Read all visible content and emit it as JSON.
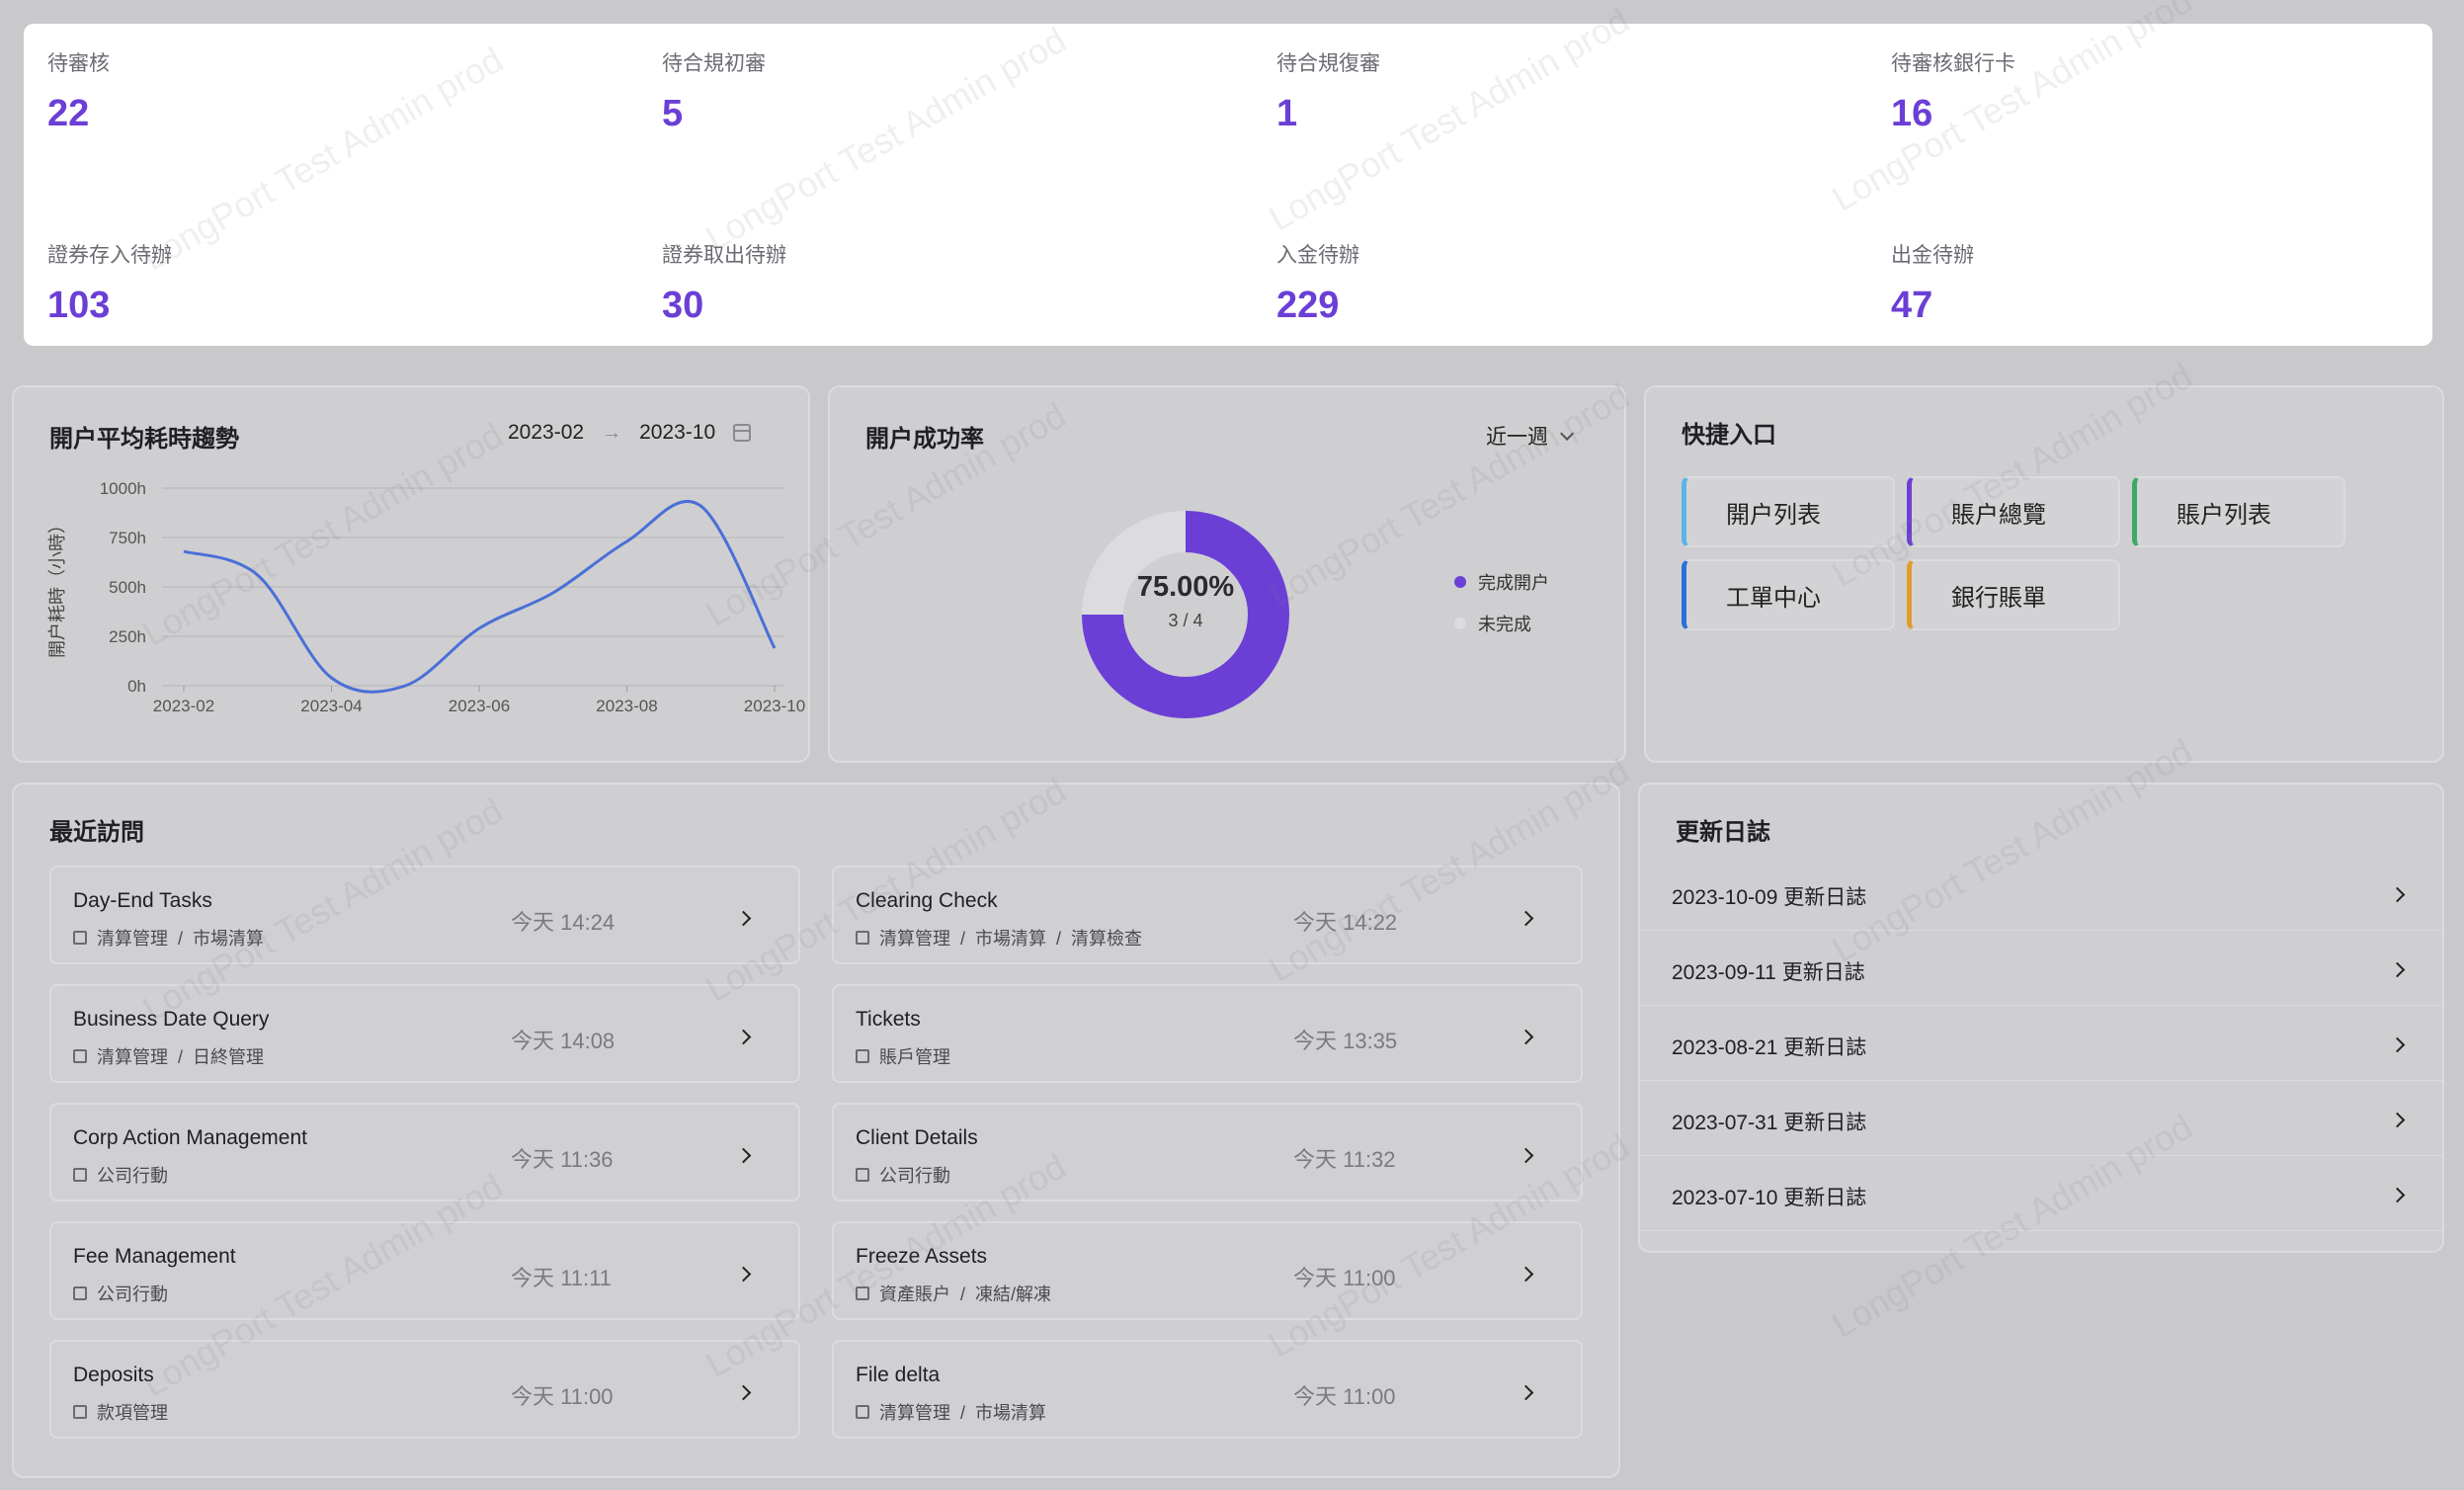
{
  "stats": [
    {
      "label": "待審核",
      "value": "22"
    },
    {
      "label": "待合規初審",
      "value": "5"
    },
    {
      "label": "待合規復審",
      "value": "1"
    },
    {
      "label": "待審核銀行卡",
      "value": "16"
    },
    {
      "label": "證券存入待辦",
      "value": "103"
    },
    {
      "label": "證券取出待辦",
      "value": "30"
    },
    {
      "label": "入金待辦",
      "value": "229"
    },
    {
      "label": "出金待辦",
      "value": "47"
    }
  ],
  "trend": {
    "title": "開户平均耗時趨勢",
    "range_start": "2023-02",
    "range_end": "2023-10",
    "range_arrow": "→"
  },
  "chart_data": {
    "type": "line",
    "title": "開户平均耗時趨勢",
    "ylabel": "開户耗時（小時）",
    "xlabel": "",
    "x": [
      "2023-02",
      "2023-03",
      "2023-04",
      "2023-05",
      "2023-06",
      "2023-07",
      "2023-08",
      "2023-09",
      "2023-10"
    ],
    "y_ticks": [
      "0h",
      "250h",
      "500h",
      "750h",
      "1000h"
    ],
    "x_ticks": [
      "2023-02",
      "2023-04",
      "2023-06",
      "2023-08",
      "2023-10"
    ],
    "ylim": [
      0,
      1000
    ],
    "series": [
      {
        "values": [
          680,
          560,
          40,
          0,
          290,
          470,
          730,
          910,
          190
        ],
        "color": "#4a6fd8"
      }
    ],
    "grid": true
  },
  "donut": {
    "title": "開户成功率",
    "period": "近一週",
    "percent_text": "75.00%",
    "ratio_text": "3 / 4",
    "completed_fraction": 0.75,
    "legend": [
      {
        "label": "完成開户",
        "color": "#6b3fd6"
      },
      {
        "label": "未完成",
        "color": "#dcdcde"
      }
    ]
  },
  "shortcuts": {
    "title": "快捷入口",
    "items": [
      {
        "label": "開户列表",
        "color": "#5ab4e6"
      },
      {
        "label": "賬户總覽",
        "color": "#6b3fd6"
      },
      {
        "label": "賬户列表",
        "color": "#3fa868"
      },
      {
        "label": "工單中心",
        "color": "#2d6fd9"
      },
      {
        "label": "銀行賬單",
        "color": "#e09c2e"
      }
    ]
  },
  "recent": {
    "title": "最近訪問",
    "items": [
      {
        "name": "Day-End Tasks",
        "path": "清算管理  /  市場清算",
        "time": "今天 14:24"
      },
      {
        "name": "Clearing Check",
        "path": "清算管理  /  市場清算  /  清算檢查",
        "time": "今天 14:22"
      },
      {
        "name": "Business Date Query",
        "path": "清算管理  /  日終管理",
        "time": "今天 14:08"
      },
      {
        "name": "Tickets",
        "path": "賬戶管理",
        "time": "今天 13:35"
      },
      {
        "name": "Corp Action Management",
        "path": "公司行動",
        "time": "今天 11:36"
      },
      {
        "name": "Client Details",
        "path": "公司行動",
        "time": "今天 11:32"
      },
      {
        "name": "Fee Management",
        "path": "公司行動",
        "time": "今天 11:11"
      },
      {
        "name": "Freeze Assets",
        "path": "資產賬户  /  凍結/解凍",
        "time": "今天 11:00"
      },
      {
        "name": "Deposits",
        "path": "款項管理",
        "time": "今天 11:00"
      },
      {
        "name": "File delta",
        "path": "清算管理  /  市場清算",
        "time": "今天 11:00"
      }
    ]
  },
  "changelog": {
    "title": "更新日誌",
    "items": [
      "2023-10-09 更新日誌",
      "2023-09-11 更新日誌",
      "2023-08-21 更新日誌",
      "2023-07-31 更新日誌",
      "2023-07-10 更新日誌"
    ]
  },
  "watermark": "LongPort Test Admin prod"
}
